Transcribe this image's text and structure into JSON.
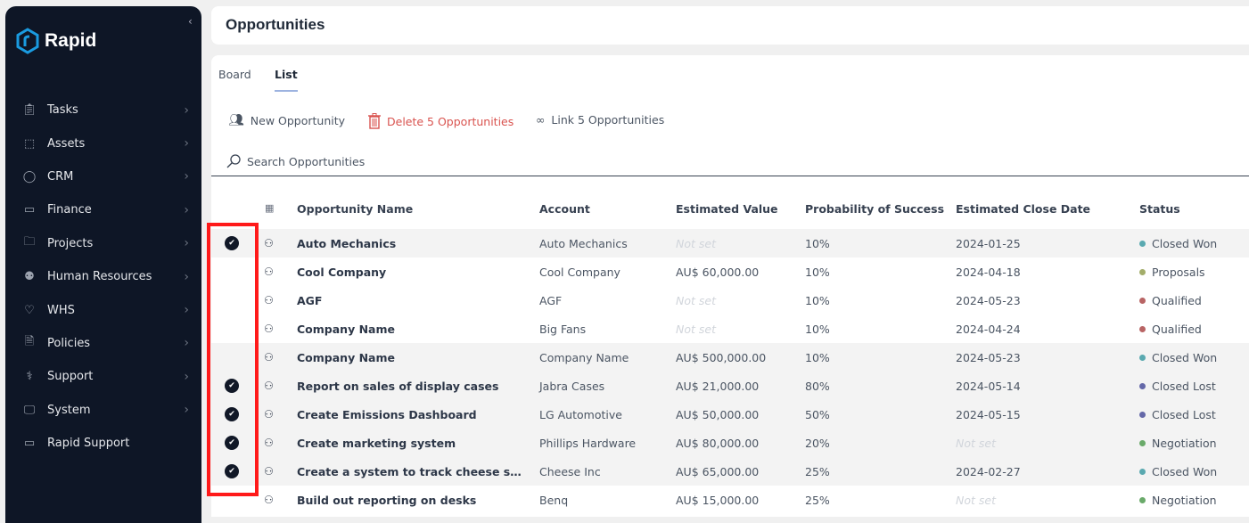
{
  "app": {
    "name": "Rapid",
    "brand_color": "#1a9be0"
  },
  "sidebar": {
    "items": [
      {
        "label": "Tasks",
        "icon": "clipboard-check-icon"
      },
      {
        "label": "Assets",
        "icon": "box-icon"
      },
      {
        "label": "CRM",
        "icon": "user-icon"
      },
      {
        "label": "Finance",
        "icon": "money-icon"
      },
      {
        "label": "Projects",
        "icon": "folder-icon"
      },
      {
        "label": "Human Resources",
        "icon": "people-icon"
      },
      {
        "label": "WHS",
        "icon": "heart-pulse-icon"
      },
      {
        "label": "Policies",
        "icon": "document-icon"
      },
      {
        "label": "Support",
        "icon": "stethoscope-icon"
      },
      {
        "label": "System",
        "icon": "monitor-icon"
      },
      {
        "label": "Rapid Support",
        "icon": "ticket-icon"
      }
    ]
  },
  "header": {
    "title": "Opportunities"
  },
  "tabs": [
    {
      "label": "Board",
      "active": false
    },
    {
      "label": "List",
      "active": true
    }
  ],
  "toolbar": {
    "new": "New Opportunity",
    "delete": "Delete 5 Opportunities",
    "link": "Link 5 Opportunities"
  },
  "search": {
    "placeholder": "Search Opportunities"
  },
  "table": {
    "columns": [
      "Opportunity Name",
      "Account",
      "Estimated Value",
      "Probability of Success",
      "Estimated Close Date",
      "Status"
    ],
    "rows": [
      {
        "selected": true,
        "name": "Auto Mechanics",
        "account": "Auto Mechanics",
        "value": "Not set",
        "prob": "10%",
        "date": "2024-01-25",
        "status": "Closed Won",
        "color": "#5aa9b0"
      },
      {
        "selected": false,
        "name": "Cool Company",
        "account": "Cool Company",
        "value": "AU$ 60,000.00",
        "prob": "10%",
        "date": "2024-04-18",
        "status": "Proposals",
        "color": "#a3ad6a"
      },
      {
        "selected": false,
        "name": "AGF",
        "account": "AGF",
        "value": "Not set",
        "prob": "10%",
        "date": "2024-05-23",
        "status": "Qualified",
        "color": "#b86464"
      },
      {
        "selected": false,
        "name": "Company Name",
        "account": "Big Fans",
        "value": "Not set",
        "prob": "10%",
        "date": "2024-04-24",
        "status": "Qualified",
        "color": "#b86464"
      },
      {
        "selected": false,
        "name": "Company Name",
        "account": "Company Name",
        "value": "AU$ 500,000.00",
        "prob": "10%",
        "date": "2024-05-23",
        "status": "Closed Won",
        "color": "#5aa9b0"
      },
      {
        "selected": true,
        "name": "Report on sales of display cases",
        "account": "Jabra Cases",
        "value": "AU$ 21,000.00",
        "prob": "80%",
        "date": "2024-05-14",
        "status": "Closed Lost",
        "color": "#6468a8"
      },
      {
        "selected": true,
        "name": "Create Emissions Dashboard",
        "account": "LG Automotive",
        "value": "AU$ 50,000.00",
        "prob": "50%",
        "date": "2024-05-15",
        "status": "Closed Lost",
        "color": "#6468a8"
      },
      {
        "selected": true,
        "name": "Create marketing system",
        "account": "Phillips Hardware",
        "value": "AU$ 80,000.00",
        "prob": "20%",
        "date": "Not set",
        "status": "Negotiation",
        "color": "#6aaa6a"
      },
      {
        "selected": true,
        "name": "Create a system to track cheese shipments",
        "account": "Cheese Inc",
        "value": "AU$ 65,000.00",
        "prob": "25%",
        "date": "2024-02-27",
        "status": "Closed Won",
        "color": "#5aa9b0"
      },
      {
        "selected": false,
        "name": "Build out reporting on desks",
        "account": "Benq",
        "value": "AU$ 15,000.00",
        "prob": "25%",
        "date": "Not set",
        "status": "Negotiation",
        "color": "#6aaa6a"
      }
    ]
  }
}
